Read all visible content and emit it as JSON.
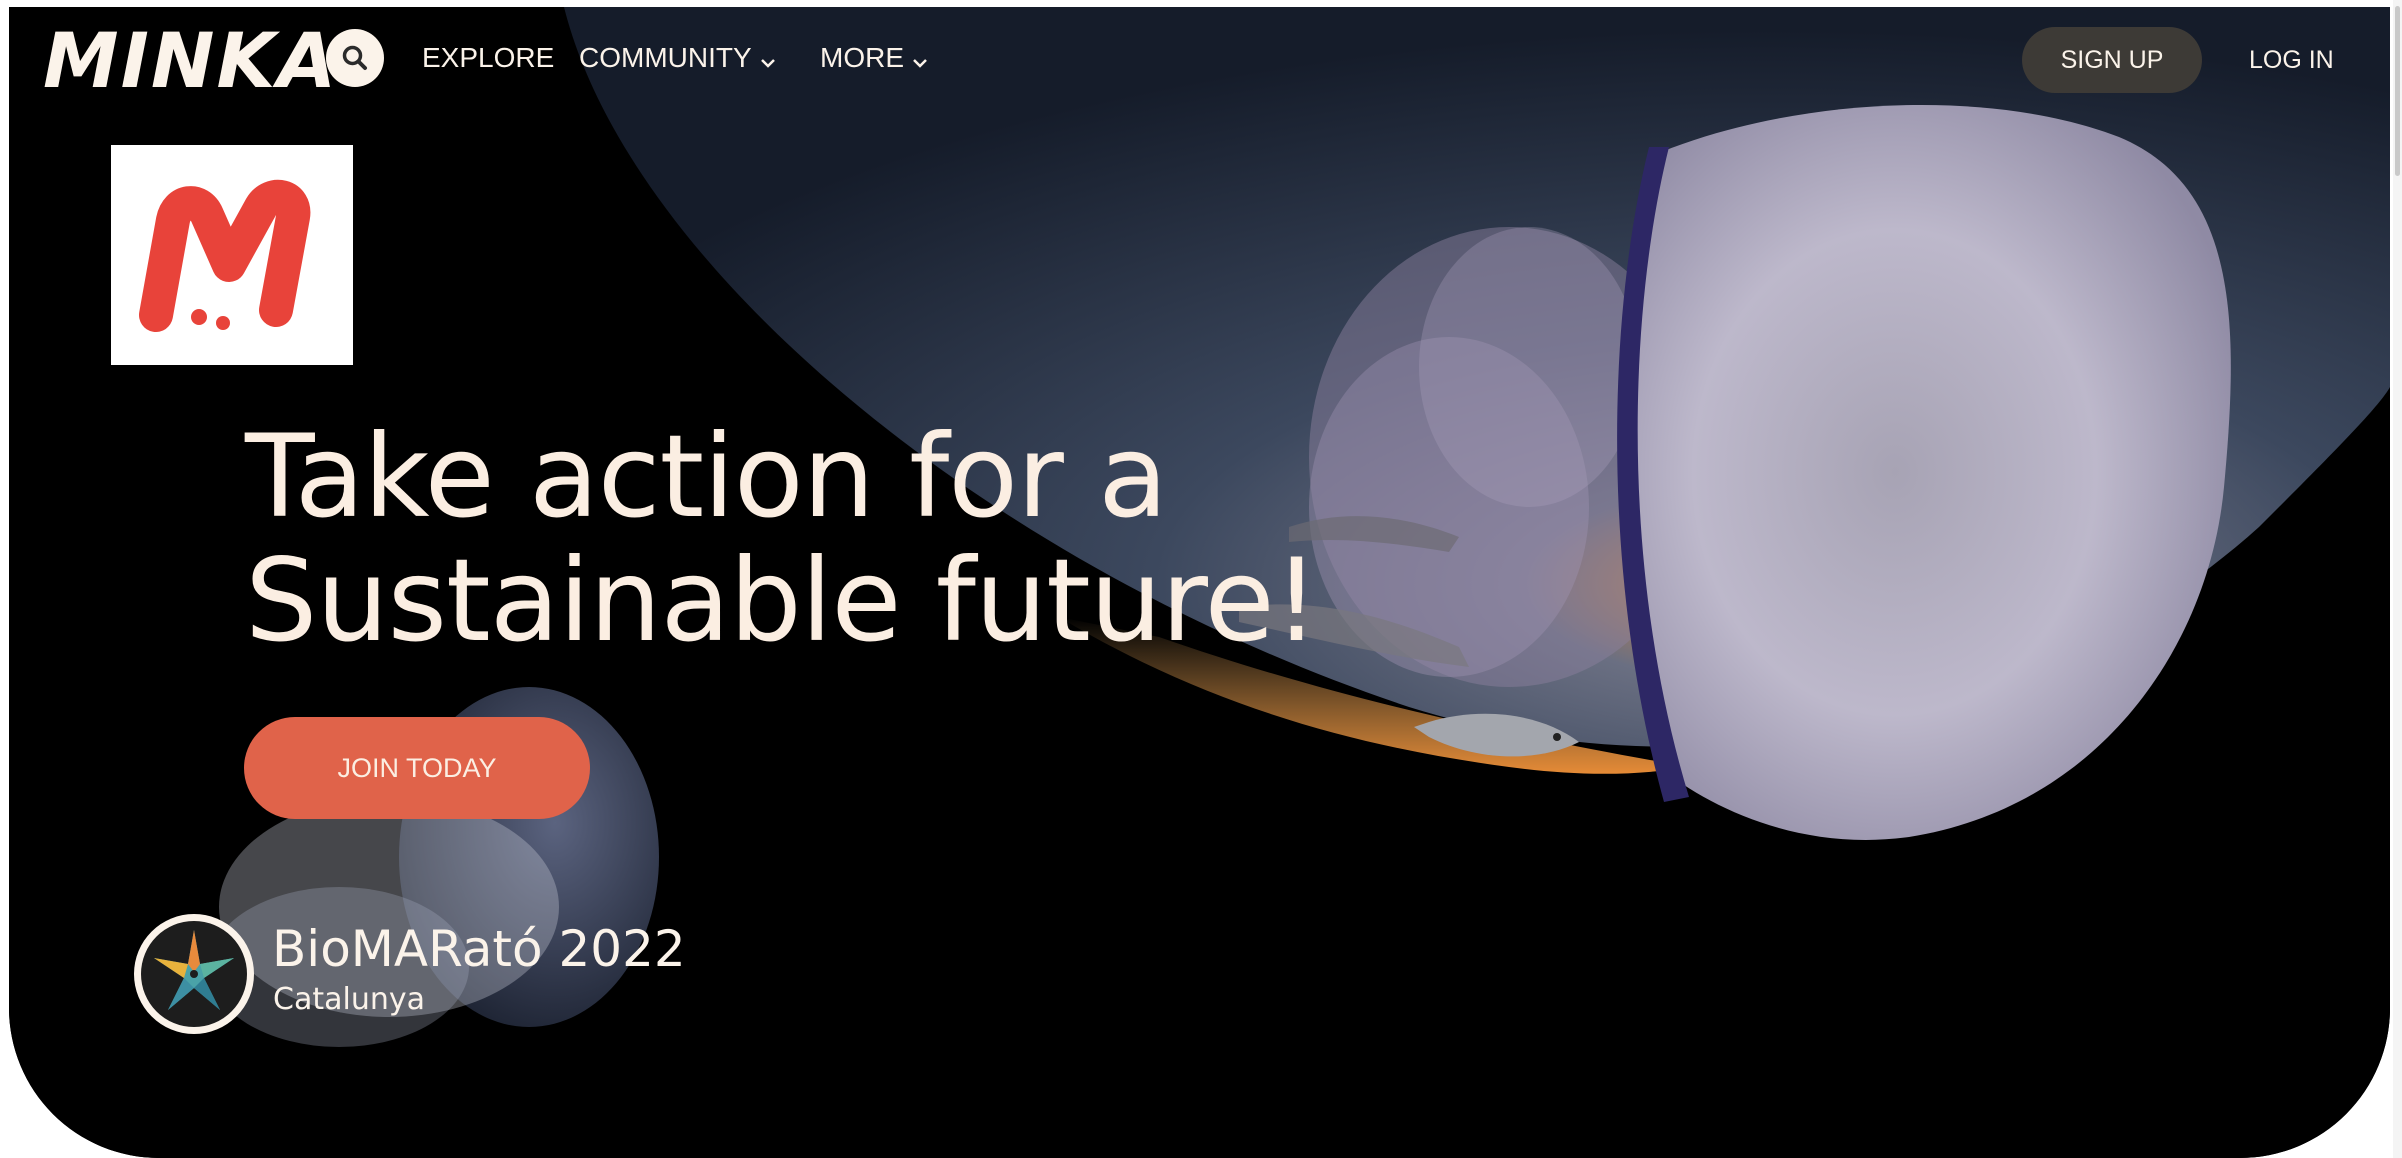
{
  "brand": {
    "wordmark": "MINKA",
    "tile_letter": "M",
    "accent": "#e0634a",
    "cream": "#fbf3ea"
  },
  "nav": {
    "search_icon": "magnifier",
    "items": [
      {
        "label": "EXPLORE"
      },
      {
        "label": "COMMUNITY",
        "icon": "chevron-down"
      },
      {
        "label": "MORE",
        "icon": "chevron-down"
      }
    ],
    "signup_label": "SIGN UP",
    "login_label": "LOG IN"
  },
  "hero": {
    "headline_line1": "Take action for a",
    "headline_line2": "Sustainable future!",
    "cta_label": "JOIN TODAY",
    "background": "underwater photo of a barrel jellyfish and small fish against a sunset surface"
  },
  "project": {
    "title": "BioMARató 2022",
    "subtitle": "Catalunya",
    "icon": "starfish-logo-icon"
  }
}
